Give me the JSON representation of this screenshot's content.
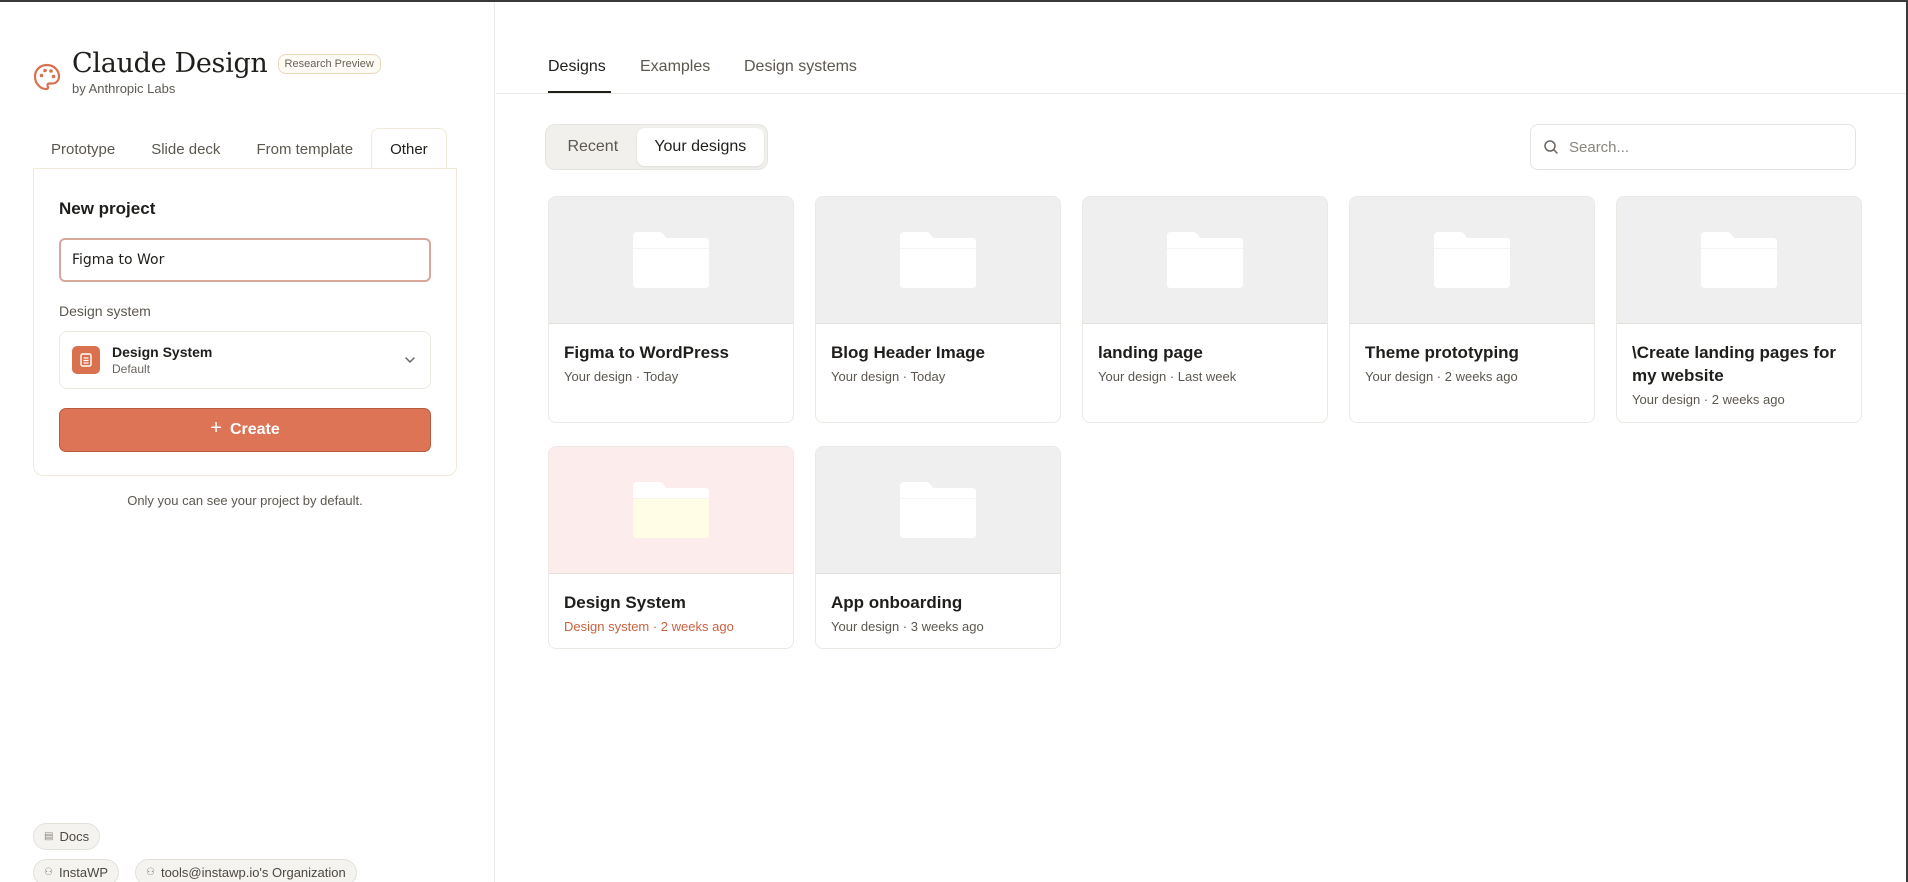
{
  "brand": {
    "title": "Claude Design",
    "badge": "Research Preview",
    "subtitle": "by Anthropic Labs"
  },
  "new_project": {
    "tabs": [
      {
        "label": "Prototype"
      },
      {
        "label": "Slide deck"
      },
      {
        "label": "From template"
      },
      {
        "label": "Other"
      }
    ],
    "active_tab": "Other",
    "heading": "New project",
    "name_value": "Figma to Wor",
    "design_system_label": "Design system",
    "design_system_name": "Design System",
    "design_system_default": "Default",
    "create_label": "Create",
    "privacy_note": "Only you can see your project by default."
  },
  "footer": {
    "docs": "Docs",
    "workspace": "InstaWP",
    "organization": "tools@instawp.io's Organization"
  },
  "main": {
    "tabs": [
      {
        "label": "Designs"
      },
      {
        "label": "Examples"
      },
      {
        "label": "Design systems"
      }
    ],
    "active_tab": "Designs",
    "segments": [
      {
        "label": "Recent"
      },
      {
        "label": "Your designs"
      }
    ],
    "active_segment": "Your designs",
    "search_placeholder": "Search..."
  },
  "designs": [
    {
      "title": "Figma to WordPress",
      "meta": "Your design · Today"
    },
    {
      "title": "Blog Header Image",
      "meta": "Your design · Today"
    },
    {
      "title": "landing page",
      "meta": "Your design · Last week"
    },
    {
      "title": "Theme prototyping",
      "meta": "Your design · 2 weeks ago"
    },
    {
      "title": "\\Create landing pages for my website",
      "meta": "Your design · 2 weeks ago"
    },
    {
      "title": "Design System",
      "meta": "Design system · 2 weeks ago"
    },
    {
      "title": "App onboarding",
      "meta": "Your design · 3 weeks ago"
    }
  ],
  "colors": {
    "accent": "#dc7455",
    "accent_text": "#c9623f",
    "design_system_thumb": "#fdecec"
  },
  "icons": {
    "brand": "palette-icon",
    "search": "search-icon",
    "folder": "folder-icon",
    "chevron": "chevron-down-icon",
    "plus": "plus-icon"
  }
}
